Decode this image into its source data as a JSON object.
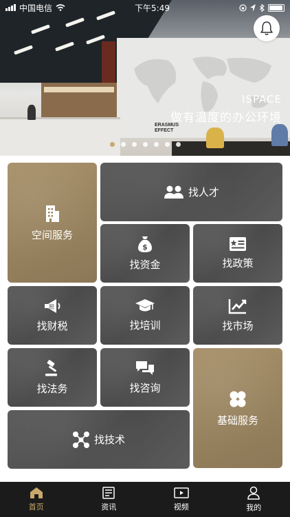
{
  "status_bar": {
    "carrier": "中国电信",
    "time": "下午5:49"
  },
  "banner": {
    "title_en": "ISPACE",
    "title_cn": "做有温度的办公环境",
    "logo_line1": "ERASMUS",
    "logo_line2": "EFFECT",
    "pages": 7,
    "active_page": 1
  },
  "services": {
    "space": "空间服务",
    "talent": "找人才",
    "funding": "找资金",
    "policy": "找政策",
    "tax": "找财税",
    "training": "找培训",
    "market": "找市场",
    "legal": "找法务",
    "consult": "找咨询",
    "basic": "基础服务",
    "tech": "找技术"
  },
  "tabbar": {
    "items": [
      {
        "label": "首页",
        "icon": "home-icon",
        "active": true
      },
      {
        "label": "资讯",
        "icon": "news-icon",
        "active": false
      },
      {
        "label": "视频",
        "icon": "video-icon",
        "active": false
      },
      {
        "label": "我的",
        "icon": "profile-icon",
        "active": false
      }
    ]
  },
  "colors": {
    "accent": "#c9a86b",
    "tile_dark": "#4f4f4f",
    "tile_gold": "#9a845f",
    "tabbar": "#1b1b1b"
  }
}
